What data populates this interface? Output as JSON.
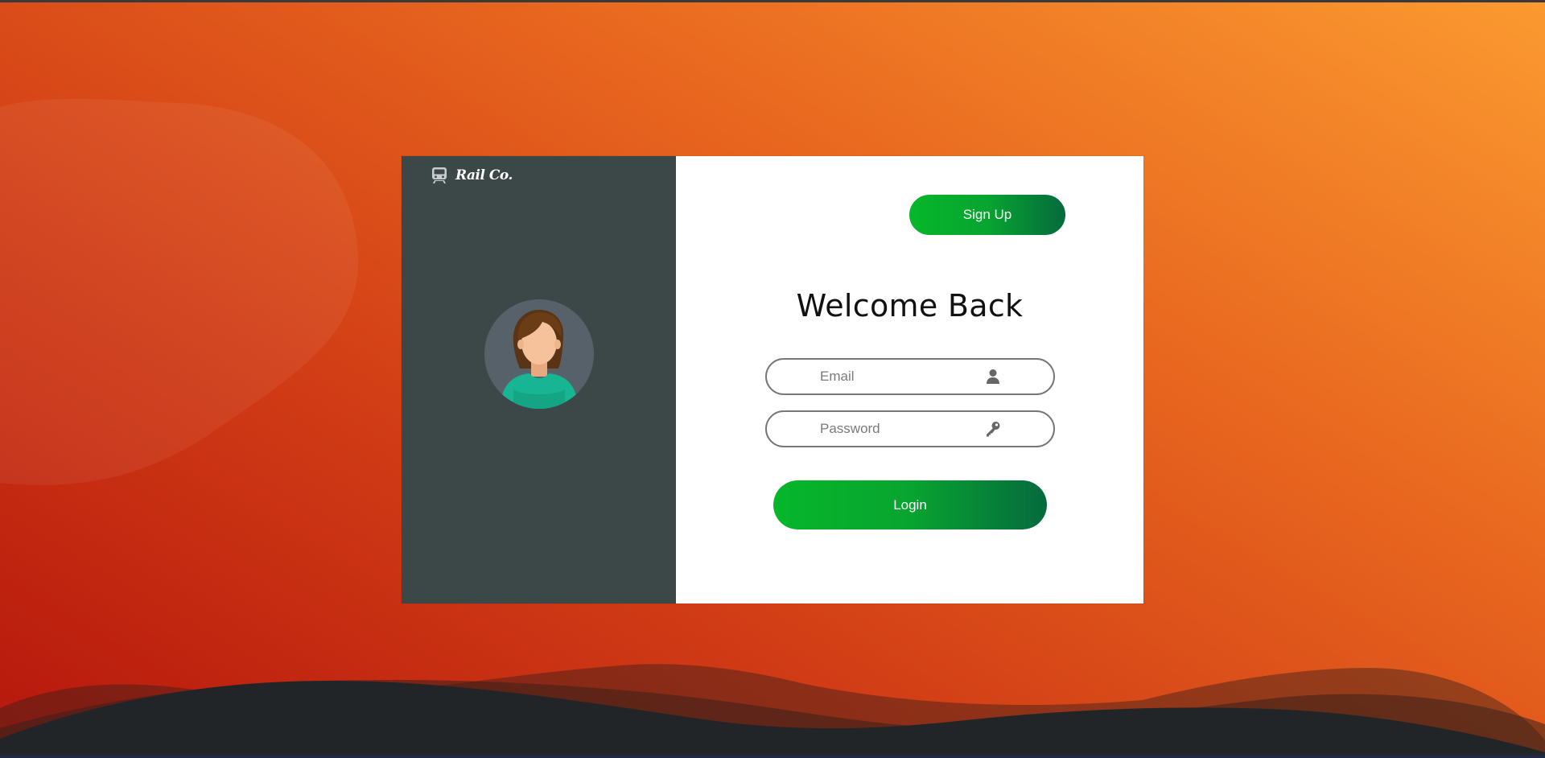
{
  "brand": {
    "name": "Rail Co.",
    "icon": "train-icon"
  },
  "avatar": {
    "icon": "user-avatar"
  },
  "header": {
    "signup_label": "Sign Up"
  },
  "main": {
    "title": "Welcome Back",
    "email": {
      "placeholder": "Email",
      "value": "",
      "icon": "user-icon"
    },
    "password": {
      "placeholder": "Password",
      "value": "",
      "icon": "key-icon"
    },
    "login_label": "Login"
  },
  "colors": {
    "accent_start": "#06b72a",
    "accent_end": "#056a3d",
    "sidebar": "#3c4747",
    "background_start": "#b5160c",
    "background_end": "#fb9a30"
  }
}
